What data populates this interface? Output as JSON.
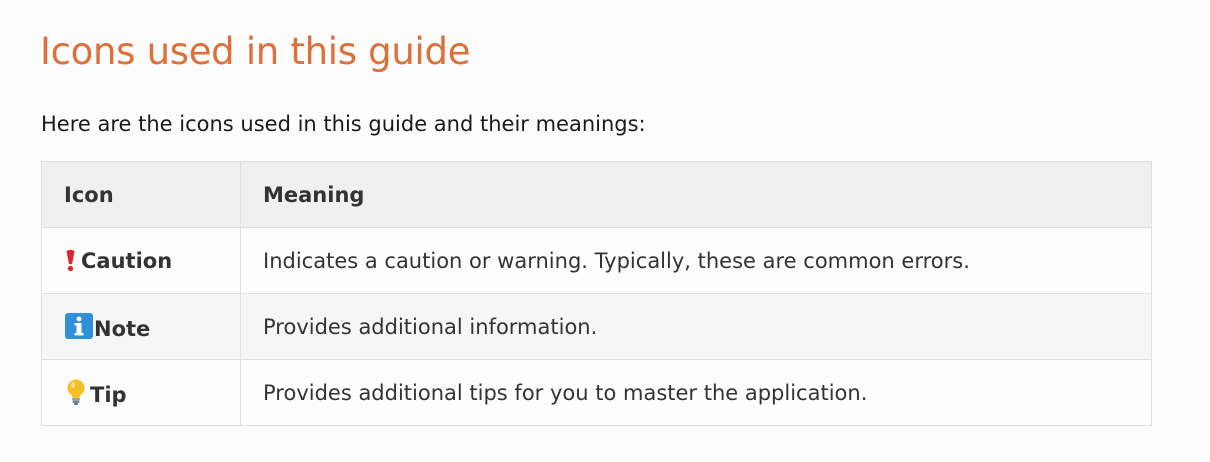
{
  "heading": "Icons used in this guide",
  "intro": "Here are the icons used in this guide and their meanings:",
  "table": {
    "headers": [
      "Icon",
      "Meaning"
    ],
    "rows": [
      {
        "icon": "exclamation-mark-icon",
        "icon_color": "#e0242f",
        "label": "Caution",
        "meaning": "Indicates a caution or warning. Typically, these are common errors."
      },
      {
        "icon": "information-icon",
        "icon_color": "#2f8fd8",
        "label": "Note",
        "meaning": "Provides additional information."
      },
      {
        "icon": "light-bulb-icon",
        "icon_color": "#f5c024",
        "label": "Tip",
        "meaning": "Provides additional tips for you to master the application."
      }
    ]
  },
  "colors": {
    "heading": "#dd6f38",
    "header_bg": "#f0f0f0",
    "border": "#e0e0e0"
  }
}
